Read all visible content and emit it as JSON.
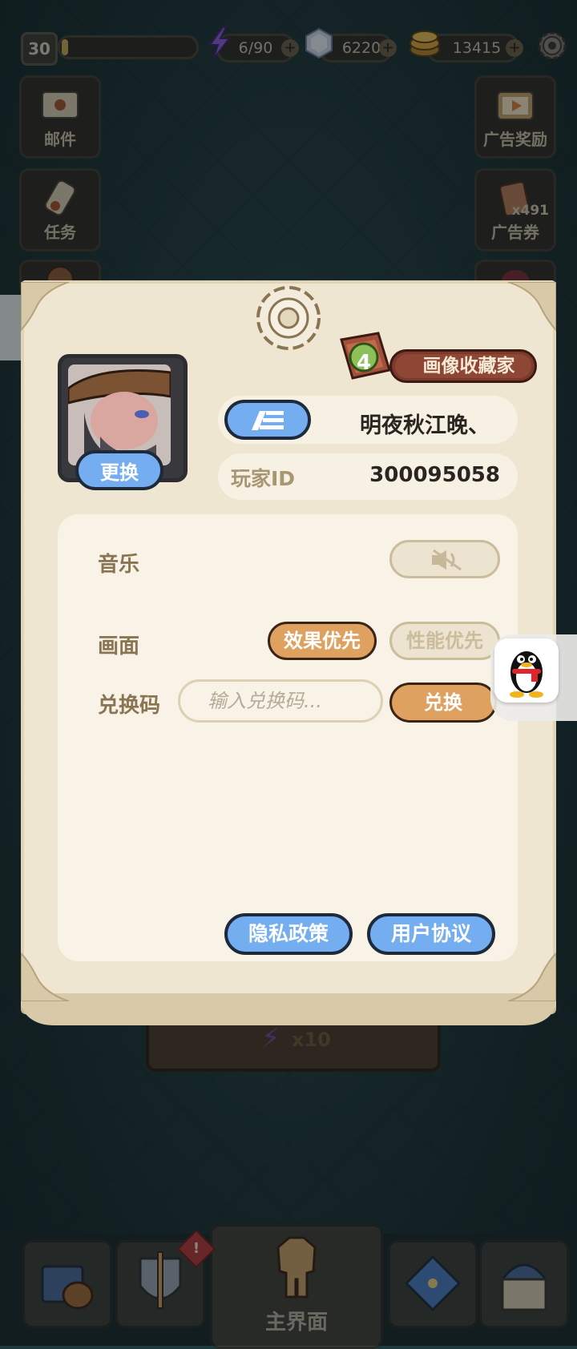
{
  "topbar": {
    "level": "30",
    "xp_fraction": 0.05,
    "energy": "6/90",
    "gems": "6220",
    "gold": "13415"
  },
  "side_left": [
    {
      "label": "邮件"
    },
    {
      "label": "任务"
    }
  ],
  "side_right": [
    {
      "label": "广告奖励"
    },
    {
      "label": "广告券",
      "count": "x491"
    }
  ],
  "behind": {
    "cost": "x10"
  },
  "bottom_nav": {
    "main_label": "主界面",
    "alert_badge": "!"
  },
  "profile": {
    "change_avatar_label": "更换",
    "title_level": "4",
    "title_name": "画像收藏家",
    "player_name": "明夜秋江晚、",
    "player_id_label": "玩家ID",
    "player_id": "300095058"
  },
  "settings": {
    "music_label": "音乐",
    "graphics_label": "画面",
    "graphics_option_quality": "效果优先",
    "graphics_option_performance": "性能优先",
    "graphics_selected": "效果优先",
    "redeem_label": "兑换码",
    "redeem_placeholder": "输入兑换码...",
    "redeem_button": "兑换",
    "privacy_button": "隐私政策",
    "agreement_button": "用户协议"
  },
  "colors": {
    "accent_blue": "#74aef0",
    "accent_orange": "#dea15f",
    "panel_bg": "#efe6d1",
    "ribbon": "#8f4735"
  }
}
